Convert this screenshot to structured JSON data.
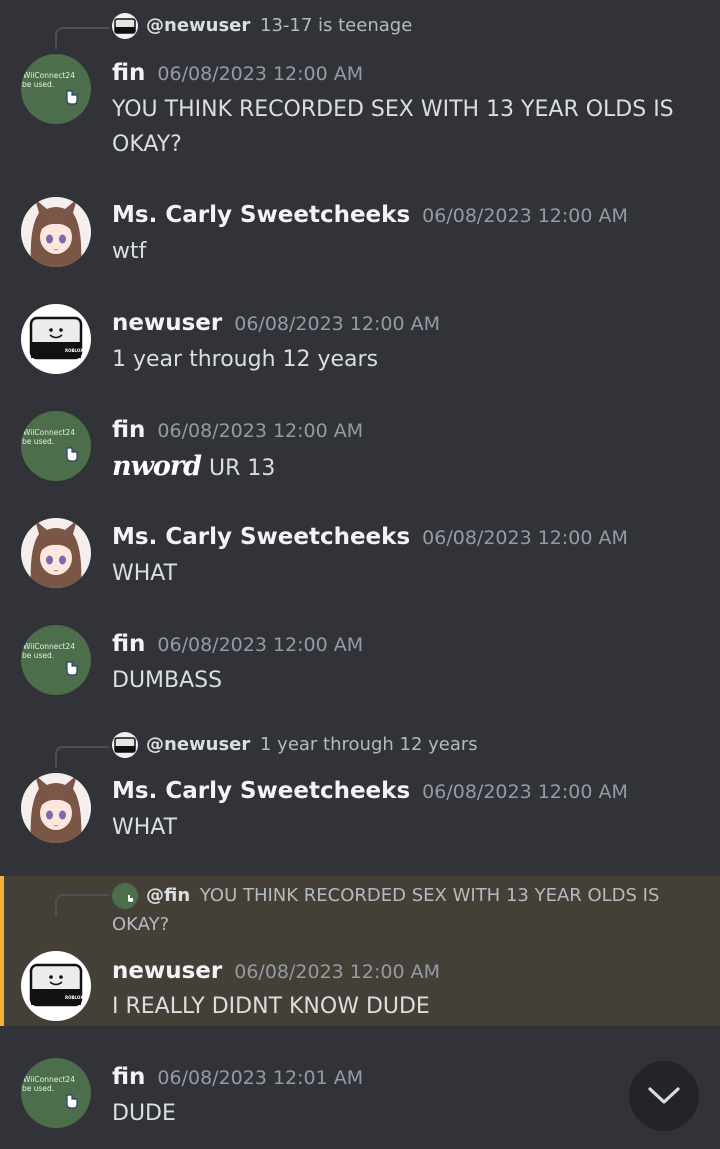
{
  "messages": [
    {
      "reply": {
        "name": "@newuser",
        "text": "13-17 is teenage"
      },
      "author": "fin",
      "timestamp": "06/08/2023 12:00 AM",
      "content": "YOU THINK RECORDED SEX WITH 13 YEAR OLDS IS OKAY?"
    },
    {
      "author": "Ms. Carly Sweetcheeks",
      "timestamp": "06/08/2023 12:00 AM",
      "content": "wtf"
    },
    {
      "author": "newuser",
      "timestamp": "06/08/2023 12:00 AM",
      "content": "1 year through 12 years"
    },
    {
      "author": "fin",
      "timestamp": "06/08/2023 12:00 AM",
      "overlay": "nword",
      "content": "UR 13"
    },
    {
      "author": "Ms. Carly Sweetcheeks",
      "timestamp": "06/08/2023 12:00 AM",
      "content": "WHAT"
    },
    {
      "author": "fin",
      "timestamp": "06/08/2023 12:00 AM",
      "content": "DUMBASS"
    },
    {
      "reply": {
        "name": "@newuser",
        "text": "1 year through 12 years"
      },
      "author": "Ms. Carly Sweetcheeks",
      "timestamp": "06/08/2023 12:00 AM",
      "content": "WHAT"
    },
    {
      "reply": {
        "name": "@fin",
        "text": "YOU THINK RECORDED SEX WITH 13 YEAR OLDS IS",
        "text2": "OKAY?"
      },
      "author": "newuser",
      "timestamp": "06/08/2023 12:00 AM",
      "content": "I REALLY DIDNT KNOW DUDE",
      "highlighted": true
    },
    {
      "author": "fin",
      "timestamp": "06/08/2023 12:01 AM",
      "content": "DUDE"
    }
  ],
  "avatars": {
    "fin": {
      "line1": "WiiConnect24",
      "line2": "be used."
    },
    "newuser": {
      "brand": "ROBLOX"
    }
  },
  "icons": {
    "jump": "chevron-down-icon"
  },
  "colors": {
    "background": "#313338",
    "mention_highlight": "#444037",
    "mention_bar": "#f0b232",
    "fin_avatar": "#4d6e4b"
  }
}
